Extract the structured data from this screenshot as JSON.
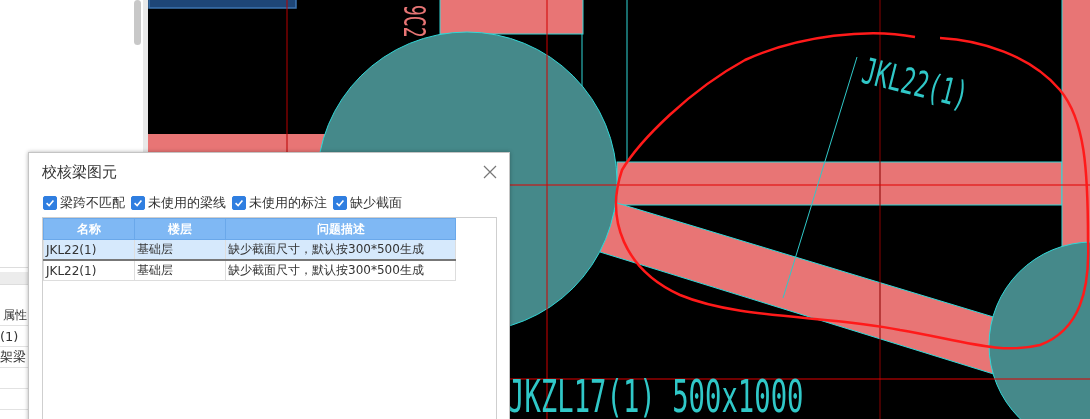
{
  "side_panel": {
    "property_table": {
      "column_1": "属性",
      "rows": [
        "(1)",
        "架梁"
      ]
    }
  },
  "canvas": {
    "top_mark": "9C2",
    "beam_label": "JKL22(1)",
    "bottom_label": "JKZL17(1) 500x1000"
  },
  "dialog": {
    "title": "校核梁图元",
    "filters": [
      {
        "label": "梁跨不匹配",
        "checked": true
      },
      {
        "label": "未使用的梁线",
        "checked": true
      },
      {
        "label": "未使用的标注",
        "checked": true
      },
      {
        "label": "缺少截面",
        "checked": true
      }
    ],
    "table": {
      "columns": [
        "名称",
        "楼层",
        "问题描述"
      ],
      "rows": [
        {
          "cells": [
            "JKL22(1)",
            "基础层",
            "缺少截面尺寸，默认按300*500生成"
          ],
          "selected": true
        },
        {
          "cells": [
            "JKL22(1)",
            "基础层",
            "缺少截面尺寸，默认按300*500生成"
          ],
          "selected": false
        }
      ]
    }
  }
}
